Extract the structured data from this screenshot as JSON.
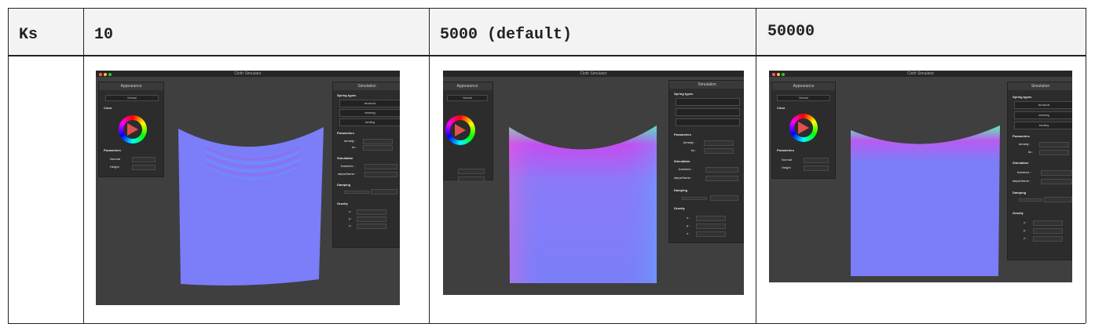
{
  "table": {
    "header": {
      "param": "Ks",
      "col1": "10",
      "col2": "5000 (default)",
      "col3": "50000"
    }
  },
  "screenshot": {
    "window_title": "Cloth Simulator",
    "appearance_panel": {
      "title": "Appearance",
      "dropdown": "Normal",
      "color_label": "Color",
      "parameters_label": "Parameters",
      "normal_label": "Normal",
      "height_label": "Height"
    },
    "simulation_panel": {
      "title": "Simulation",
      "spring_types_label": "Spring types",
      "structural": "structural",
      "shearing": "shearing",
      "bending": "bending",
      "parameters_label": "Parameters",
      "density_label": "density :",
      "ks_label": "ks :",
      "simulation_label": "Simulation",
      "frames_label": "frames/s :",
      "steps_label": "steps/frame :",
      "damping_label": "Damping",
      "gravity_label": "Gravity",
      "gx": "x :",
      "gy": "y :",
      "gz": "z :"
    }
  },
  "colors": {
    "cloth": "#7b7ef8",
    "background": "#3f3f3f",
    "panel": "#2c2c2c"
  }
}
